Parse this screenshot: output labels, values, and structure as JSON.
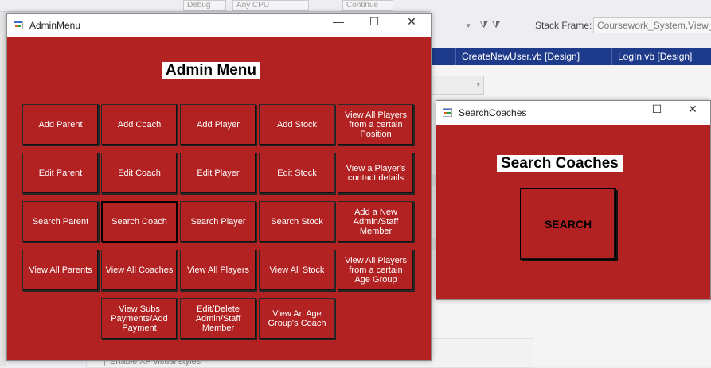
{
  "ide": {
    "toolbar_fragments": [
      "Debug",
      "Any CPU",
      "Continue"
    ],
    "stack_frame_label": "Stack Frame:",
    "stack_frame_value": "Coursework_System.View_s",
    "tabs": [
      "CreateNewUser.vb [Design]",
      "LogIn.vb [Design]"
    ],
    "checkbox_label": "Enable XP visual styles"
  },
  "admin_window": {
    "title": "AdminMenu",
    "heading": "Admin Menu",
    "buttons": [
      [
        "Add Parent",
        "Add Coach",
        "Add Player",
        "Add Stock",
        "View All Players from a certain Position"
      ],
      [
        "Edit Parent",
        "Edit Coach",
        "Edit Player",
        "Edit Stock",
        "View a Player's contact details"
      ],
      [
        "Search Parent",
        "Search Coach",
        "Search Player",
        "Search Stock",
        "Add a New Admin/Staff Member"
      ],
      [
        "View All Parents",
        "View All Coaches",
        "View All Players",
        "View All Stock",
        "View All Players from a certain Age Group"
      ],
      [
        "View Subs Payments/Add Payment",
        "Edit/Delete Admin/Staff Member",
        "View An Age Group's Coach"
      ]
    ]
  },
  "search_window": {
    "title": "SearchCoaches",
    "heading": "Search Coaches",
    "search_button": "SEARCH"
  },
  "window_controls": {
    "minimize": "—",
    "maximize": "☐",
    "close": "✕"
  },
  "colors": {
    "form_background": "#b22222",
    "ide_tab_strip": "#1e3a8a"
  }
}
